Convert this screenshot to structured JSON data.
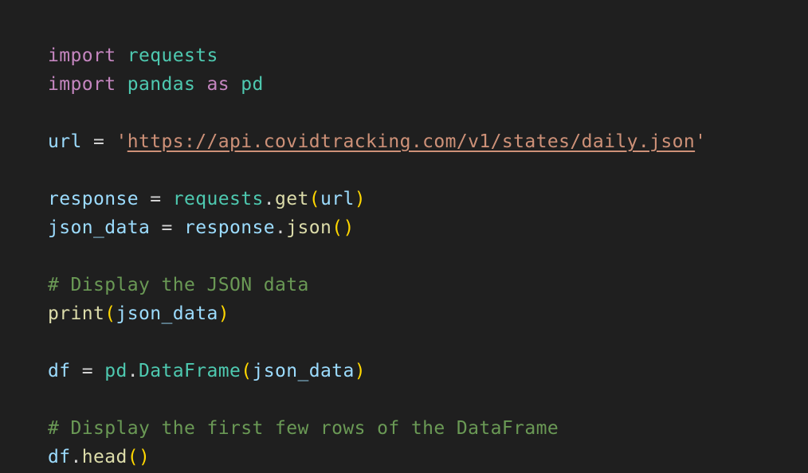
{
  "lines": [
    [
      {
        "t": "import",
        "c": "kw"
      },
      {
        "t": " ",
        "c": "plain"
      },
      {
        "t": "requests",
        "c": "mod"
      }
    ],
    [
      {
        "t": "import",
        "c": "kw"
      },
      {
        "t": " ",
        "c": "plain"
      },
      {
        "t": "pandas",
        "c": "mod"
      },
      {
        "t": " ",
        "c": "plain"
      },
      {
        "t": "as",
        "c": "kw"
      },
      {
        "t": " ",
        "c": "plain"
      },
      {
        "t": "pd",
        "c": "mod"
      }
    ],
    [],
    [
      {
        "t": "url",
        "c": "var"
      },
      {
        "t": " = ",
        "c": "op"
      },
      {
        "t": "'",
        "c": "str"
      },
      {
        "t": "https://api.covidtracking.com/v1/states/daily.json",
        "c": "url"
      },
      {
        "t": "'",
        "c": "str"
      }
    ],
    [],
    [
      {
        "t": "response",
        "c": "var"
      },
      {
        "t": " = ",
        "c": "op"
      },
      {
        "t": "requests",
        "c": "mod"
      },
      {
        "t": ".",
        "c": "plain"
      },
      {
        "t": "get",
        "c": "fn"
      },
      {
        "t": "(",
        "c": "paren"
      },
      {
        "t": "url",
        "c": "var"
      },
      {
        "t": ")",
        "c": "paren"
      }
    ],
    [
      {
        "t": "json_data",
        "c": "var"
      },
      {
        "t": " = ",
        "c": "op"
      },
      {
        "t": "response",
        "c": "var"
      },
      {
        "t": ".",
        "c": "plain"
      },
      {
        "t": "json",
        "c": "fn"
      },
      {
        "t": "()",
        "c": "paren"
      }
    ],
    [],
    [
      {
        "t": "# Display the JSON data",
        "c": "cmt"
      }
    ],
    [
      {
        "t": "print",
        "c": "fn"
      },
      {
        "t": "(",
        "c": "paren"
      },
      {
        "t": "json_data",
        "c": "var"
      },
      {
        "t": ")",
        "c": "paren"
      }
    ],
    [],
    [
      {
        "t": "df",
        "c": "var"
      },
      {
        "t": " = ",
        "c": "op"
      },
      {
        "t": "pd",
        "c": "mod"
      },
      {
        "t": ".",
        "c": "plain"
      },
      {
        "t": "DataFrame",
        "c": "cls"
      },
      {
        "t": "(",
        "c": "paren"
      },
      {
        "t": "json_data",
        "c": "var"
      },
      {
        "t": ")",
        "c": "paren"
      }
    ],
    [],
    [
      {
        "t": "# Display the first few rows of the DataFrame",
        "c": "cmt"
      }
    ],
    [
      {
        "t": "df",
        "c": "var"
      },
      {
        "t": ".",
        "c": "plain"
      },
      {
        "t": "head",
        "c": "fn"
      },
      {
        "t": "()",
        "c": "paren"
      }
    ]
  ]
}
